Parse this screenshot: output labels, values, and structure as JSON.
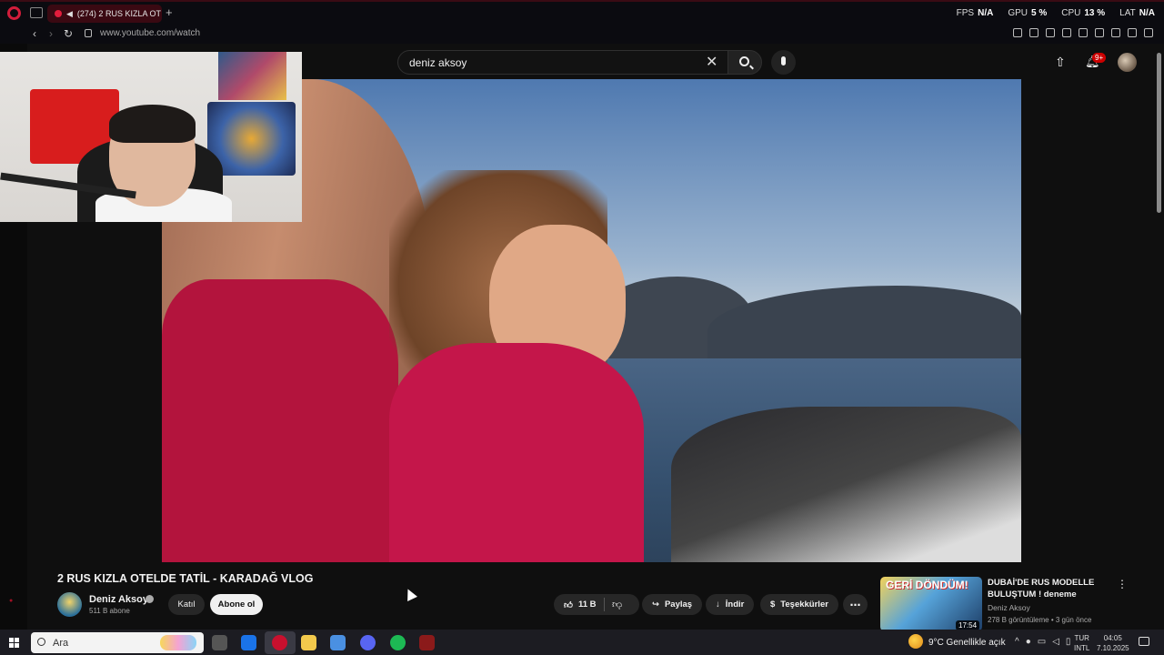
{
  "browser": {
    "tab_title": "(274) 2 RUS KIZLA OT",
    "url": "www.youtube.com/watch",
    "perf": [
      {
        "label": "FPS",
        "value": "N/A"
      },
      {
        "label": "GPU",
        "value": "5 %"
      },
      {
        "label": "CPU",
        "value": "13 %"
      },
      {
        "label": "LAT",
        "value": "N/A"
      }
    ]
  },
  "youtube": {
    "search_query": "deniz aksoy",
    "notifications": "9+",
    "video": {
      "title": "2 RUS KIZLA OTELDE TATİL - KARADAĞ VLOG",
      "channel": "Deniz Aksoy",
      "subscribers": "511 B abone",
      "join_label": "Katıl",
      "subscribe_label": "Abone ol",
      "likes": "11 B",
      "share_label": "Paylaş",
      "download_label": "İndir",
      "thanks_label": "Teşekkürler"
    },
    "recommendation": {
      "thumb_text": "GERİ DÖNDÜM!",
      "title": "DUBAİ'DE RUS MODELLE BULUŞTUM ! deneme",
      "channel": "Deniz Aksoy",
      "meta": "278 B görüntüleme • 3 gün önce",
      "duration": "17:54"
    }
  },
  "taskbar": {
    "search_placeholder": "Ara",
    "weather": "9°C  Genellikle açık",
    "lang_line1": "TUR",
    "lang_line2": "INTL",
    "time": "04:05",
    "date": "7.10.2025"
  },
  "colors": {
    "accent": "#d21d3b",
    "yt_bg": "#0f0f0f"
  }
}
